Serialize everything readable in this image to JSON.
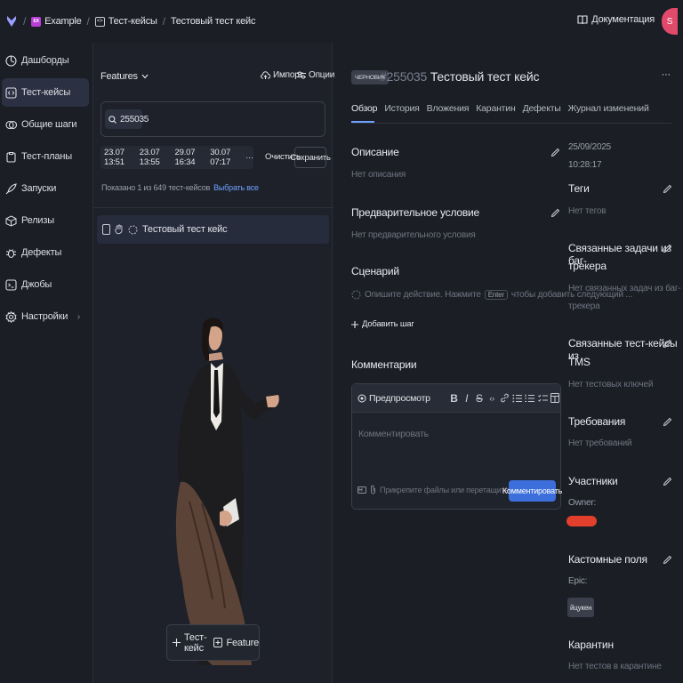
{
  "breadcrumb": {
    "project_badge": "EX",
    "project": "Example",
    "section_icon": "<>",
    "section": "Тест-кейсы",
    "current": "Тестовый тест кейс"
  },
  "header": {
    "docs_label": "Документация",
    "avatar_initial": "S"
  },
  "sidebar": {
    "items": [
      {
        "label": "Дашборды",
        "icon": "dashboard-icon"
      },
      {
        "label": "Тест-кейсы",
        "icon": "code-icon",
        "active": true
      },
      {
        "label": "Общие шаги",
        "icon": "shared-steps-icon"
      },
      {
        "label": "Тест-планы",
        "icon": "clipboard-icon"
      },
      {
        "label": "Запуски",
        "icon": "rocket-icon"
      },
      {
        "label": "Релизы",
        "icon": "package-icon"
      },
      {
        "label": "Дефекты",
        "icon": "bug-icon"
      },
      {
        "label": "Джобы",
        "icon": "terminal-icon"
      },
      {
        "label": "Настройки",
        "icon": "gear-icon"
      }
    ],
    "settings_chevron": "›"
  },
  "list_panel": {
    "group_label": "Features",
    "import_label": "Импорт",
    "options_label": "Опции",
    "search_value": "255035",
    "filters": [
      "23.07 13:51",
      "23.07 13:55",
      "29.07 16:34",
      "30.07 07:17"
    ],
    "filters_more": "···",
    "clear_label": "Очистить",
    "save_label": "Сохранить",
    "shown_text": "Показано 1 из 649 тест-кейсов",
    "select_all": "Выбрать все",
    "case_title": "Тестовый тест кейс",
    "add_case": "Тест-кейс",
    "add_feature": "Feature"
  },
  "detail": {
    "status_badge": "ЧЕРНОВИК",
    "id": "#255035",
    "title": "Тестовый тест кейс",
    "more": "···",
    "tabs": [
      "Обзор",
      "История",
      "Вложения",
      "Карантин",
      "Дефекты",
      "Журнал изменений"
    ],
    "description_title": "Описание",
    "description_empty": "Нет описания",
    "precondition_title": "Предварительное условие",
    "precondition_empty": "Нет предварительного условия",
    "scenario_title": "Сценарий",
    "step_placeholder_a": "Опишите действие. Нажмите",
    "step_key": "Enter",
    "step_placeholder_b": "чтобы добавить следующий ...",
    "add_step": "Добавить шаг",
    "comments_title": "Комментарии",
    "preview_label": "Предпросмотр",
    "comment_placeholder": "Комментировать",
    "attach_hint": "Прикрепите файлы или перетащите их",
    "comment_button": "Комментировать"
  },
  "meta": {
    "date": "25/09/2025",
    "time": "10:28:17",
    "tags_title": "Теги",
    "tags_empty": "Нет тегов",
    "issues_title_1": "Связанные задачи из баг-",
    "issues_title_2": "трекера",
    "issues_empty_1": "Нет связанных задач из баг-",
    "issues_empty_2": "трекера",
    "tms_title_1": "Связанные тест-кейсы из",
    "tms_title_2": "TMS",
    "tms_empty": "Нет тестовых ключей",
    "req_title": "Требования",
    "req_empty": "Нет требований",
    "members_title": "Участники",
    "owner_label": "Owner:",
    "custom_title": "Кастомные поля",
    "epic_label": "Epic:",
    "epic_value": "йцукен",
    "quarantine_title": "Карантин",
    "quarantine_empty": "Нет тестов в карантине"
  },
  "colors": {
    "accent": "#3d6fdc",
    "link": "#6fa0ff",
    "badge": "#b93fd6",
    "avatar": "#e24a6c",
    "redacted": "#e2402c"
  }
}
